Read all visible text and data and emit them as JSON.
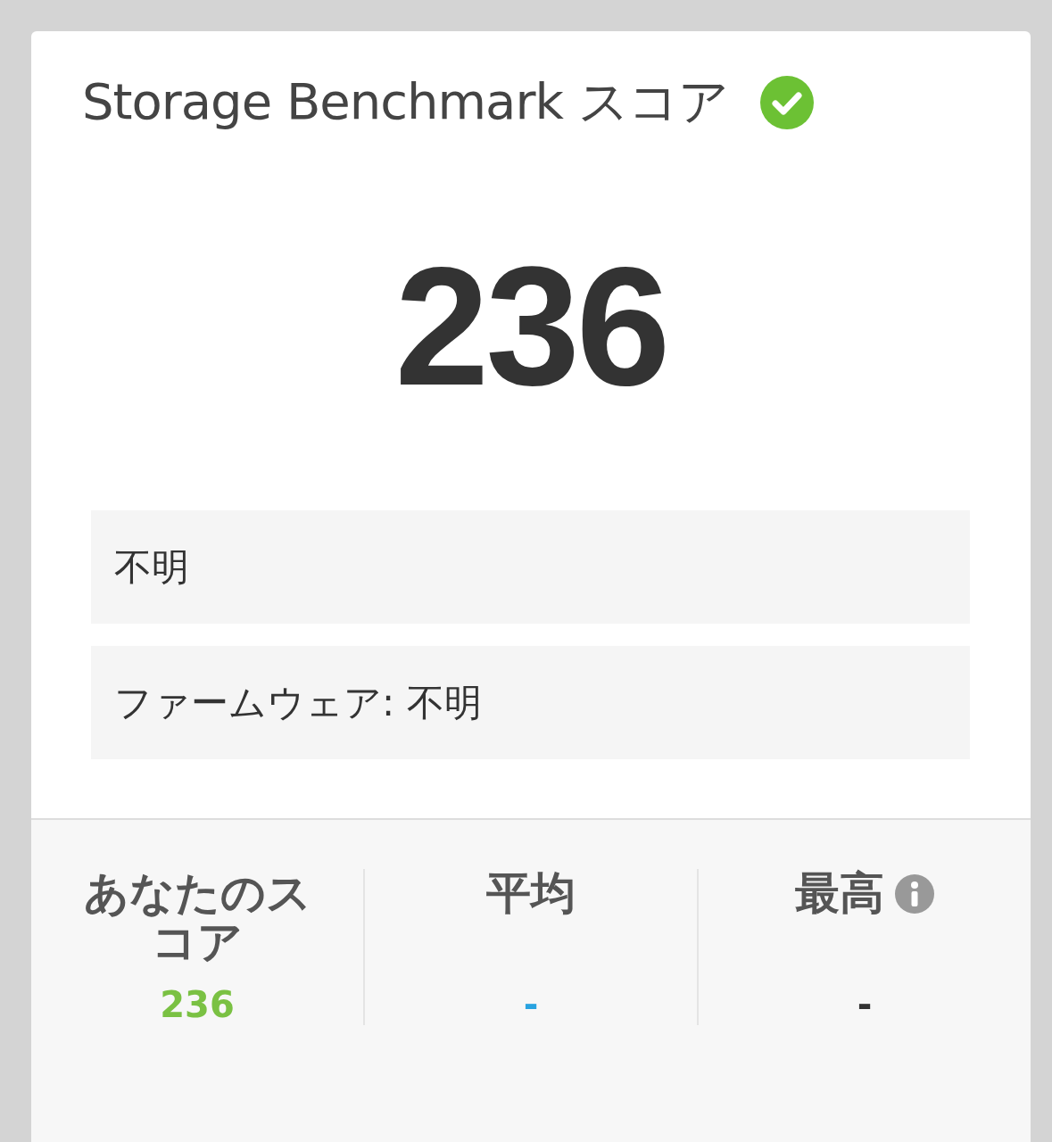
{
  "title": "Storage Benchmark スコア",
  "verified": true,
  "score": "236",
  "info_rows": [
    "不明",
    "ファームウェア: 不明"
  ],
  "stats": [
    {
      "label": "あなたのスコア",
      "value": "236",
      "kind": "yours"
    },
    {
      "label": "平均",
      "value": "-",
      "kind": "average"
    },
    {
      "label": "最高",
      "value": "-",
      "kind": "best",
      "info": true
    }
  ]
}
